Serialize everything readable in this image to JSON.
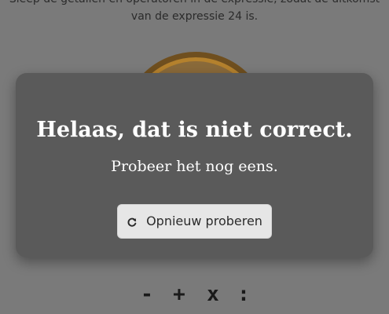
{
  "instruction": {
    "line1": "Sleep de getallen en operatoren in de expressie, zodat de uitkomst",
    "line2": "van de expressie 24 is."
  },
  "modal": {
    "title": "Helaas, dat is niet correct.",
    "subtitle": "Probeer het nog eens.",
    "retry_button": {
      "label": "Opnieuw proberen",
      "icon": "refresh-icon"
    }
  },
  "operators": [
    "-",
    "+",
    "x",
    ":"
  ],
  "colors": {
    "overlay": "#7a7a7a",
    "modal_bg": "#5a5a5a",
    "button_bg": "#e6e6e6",
    "disc_ring": "#b4812d"
  }
}
